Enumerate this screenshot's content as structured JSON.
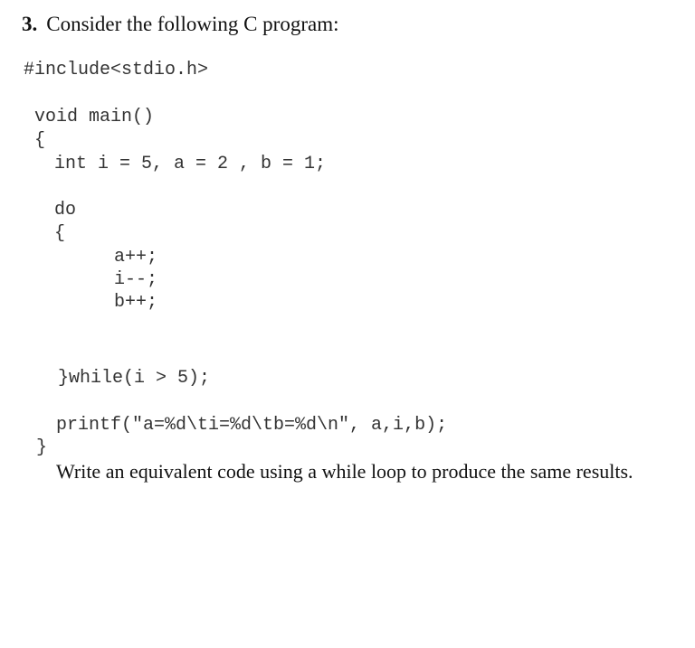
{
  "question": {
    "number": "3.",
    "title": "Consider the following C program:"
  },
  "code": {
    "lines": [
      "#include<stdio.h>",
      "void main()",
      "{",
      "int i = 5, a = 2 , b = 1;",
      "do",
      "{",
      "a++;",
      "i--;",
      "b++;",
      "}while(i > 5);",
      "printf(\"a=%d\\ti=%d\\tb=%d\\n\", a,i,b);",
      "}"
    ]
  },
  "prompt": "Write an equivalent code using a while loop to produce the same results."
}
